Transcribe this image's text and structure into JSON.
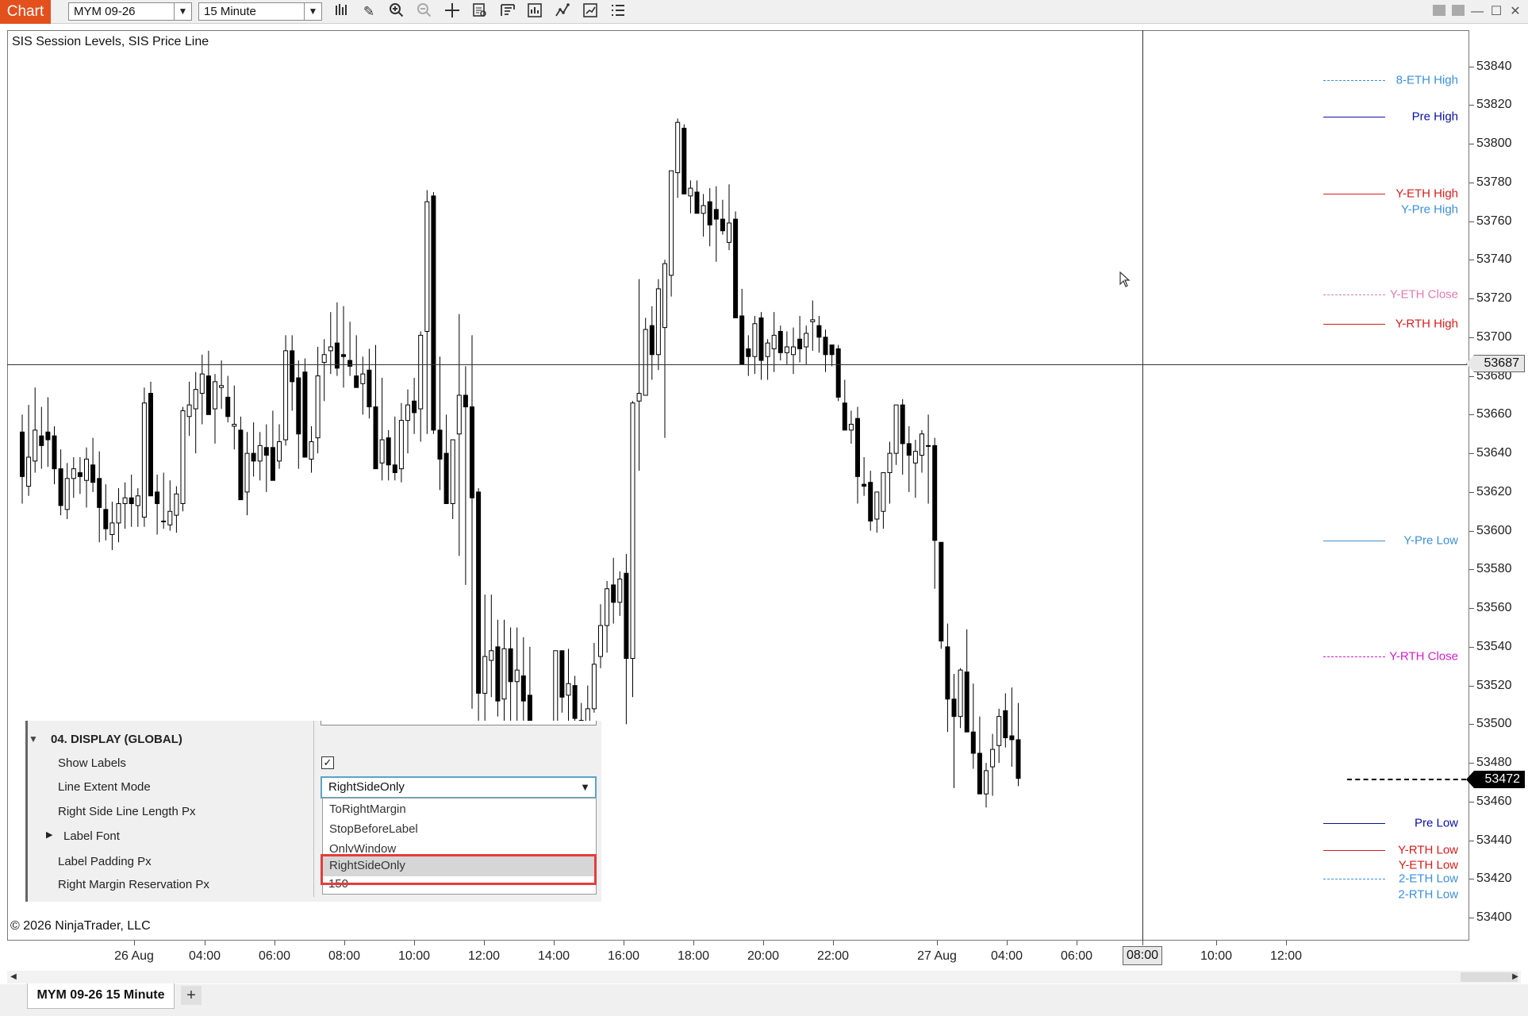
{
  "app": {
    "badge": "Chart"
  },
  "toolbar": {
    "instrument": "MYM 09-26",
    "interval": "15 Minute",
    "icons": [
      "bar-type-icon",
      "drawing-tool-icon",
      "zoom-in-icon",
      "zoom-out-icon",
      "crosshair-icon",
      "data-box-icon",
      "templates-icon",
      "properties-icon",
      "indicators-icon",
      "strategies-icon",
      "show-hide-icon"
    ]
  },
  "chart": {
    "indicator_label": "SIS Session Levels, SIS Price Line",
    "copyright": "© 2026 NinjaTrader, LLC",
    "crosshair_price": "53687",
    "crosshair_time": "08:00",
    "last_price": "53472",
    "price_ticks": [
      "53840",
      "53820",
      "53800",
      "53780",
      "53760",
      "53740",
      "53720",
      "53700",
      "53680",
      "53660",
      "53640",
      "53620",
      "53600",
      "53580",
      "53560",
      "53540",
      "53520",
      "53500",
      "53480",
      "53460",
      "53440",
      "53420",
      "53400"
    ],
    "time_ticks": [
      "26 Aug",
      "04:00",
      "06:00",
      "08:00",
      "10:00",
      "12:00",
      "14:00",
      "16:00",
      "18:00",
      "20:00",
      "22:00",
      "27 Aug",
      "04:00",
      "06:00",
      "08:00",
      "10:00",
      "12:00"
    ],
    "levels": [
      {
        "label": "8-ETH High",
        "price": 53833,
        "color": "#3d8fd8",
        "style": "dashed"
      },
      {
        "label": "Pre High",
        "price": 53814,
        "color": "#0a10a0",
        "style": "solid"
      },
      {
        "label": "Y-ETH High",
        "price": 53774,
        "color": "#d61c1c",
        "style": "solid"
      },
      {
        "label": "Y-Pre High",
        "price": 53766,
        "color": "#3d8fd8",
        "style": "none"
      },
      {
        "label": "Y-ETH Close",
        "price": 53722,
        "color": "#e07cb0",
        "style": "dashed"
      },
      {
        "label": "Y-RTH High",
        "price": 53707,
        "color": "#d61c1c",
        "style": "solid"
      },
      {
        "label": "Y-Pre Low",
        "price": 53595,
        "color": "#3d8fd8",
        "style": "solid"
      },
      {
        "label": "Y-RTH Close",
        "price": 53535,
        "color": "#d01ccc",
        "style": "dashed"
      },
      {
        "label": "Pre Low",
        "price": 53449,
        "color": "#0a10a0",
        "style": "solid"
      },
      {
        "label": "Y-RTH Low",
        "price": 53435,
        "color": "#d61c1c",
        "style": "solid"
      },
      {
        "label": "Y-ETH Low",
        "price": 53427,
        "color": "#d61c1c",
        "style": "none"
      },
      {
        "label": "2-ETH Low",
        "price": 53420,
        "color": "#3d8fd8",
        "style": "dashed"
      },
      {
        "label": "2-RTH Low",
        "price": 53412,
        "color": "#3d8fd8",
        "style": "none"
      }
    ]
  },
  "chart_data": {
    "type": "candlestick",
    "instrument": "MYM 09-26",
    "interval": "15 Minute",
    "ylim": [
      53390,
      53855
    ],
    "candles": [
      [
        53651,
        53660,
        53614,
        53628
      ],
      [
        53623,
        53665,
        53618,
        53638
      ],
      [
        53636,
        53674,
        53630,
        53652
      ],
      [
        53649,
        53664,
        53632,
        53644
      ],
      [
        53651,
        53669,
        53633,
        53647
      ],
      [
        53649,
        53654,
        53624,
        53632
      ],
      [
        53632,
        53642,
        53608,
        53613
      ],
      [
        53611,
        53635,
        53606,
        53627
      ],
      [
        53627,
        53638,
        53617,
        53632
      ],
      [
        53630,
        53638,
        53619,
        53628
      ],
      [
        53626,
        53643,
        53612,
        53637
      ],
      [
        53634,
        53648,
        53620,
        53625
      ],
      [
        53627,
        53641,
        53594,
        53612
      ],
      [
        53611,
        53624,
        53595,
        53601
      ],
      [
        53598,
        53615,
        53590,
        53604
      ],
      [
        53604,
        53622,
        53594,
        53614
      ],
      [
        53614,
        53625,
        53601,
        53617
      ],
      [
        53617,
        53629,
        53602,
        53614
      ],
      [
        53613,
        53622,
        53602,
        53618
      ],
      [
        53607,
        53674,
        53602,
        53666
      ],
      [
        53671,
        53677,
        53618,
        53618
      ],
      [
        53620,
        53629,
        53598,
        53614
      ],
      [
        53605,
        53630,
        53601,
        53605
      ],
      [
        53603,
        53626,
        53600,
        53610
      ],
      [
        53608,
        53623,
        53599,
        53619
      ],
      [
        53614,
        53664,
        53610,
        53662
      ],
      [
        53659,
        53677,
        53649,
        53665
      ],
      [
        53663,
        53682,
        53640,
        53673
      ],
      [
        53671,
        53691,
        53655,
        53681
      ],
      [
        53680,
        53693,
        53666,
        53660
      ],
      [
        53663,
        53681,
        53645,
        53677
      ],
      [
        53674,
        53688,
        53663,
        53675
      ],
      [
        53669,
        53680,
        53656,
        53659
      ],
      [
        53654,
        53675,
        53642,
        53655
      ],
      [
        53652,
        53659,
        53629,
        53616
      ],
      [
        53620,
        53651,
        53608,
        53640
      ],
      [
        53640,
        53656,
        53628,
        53636
      ],
      [
        53636,
        53651,
        53626,
        53644
      ],
      [
        53643,
        53655,
        53620,
        53639
      ],
      [
        53643,
        53662,
        53626,
        53626
      ],
      [
        53636,
        53655,
        53632,
        53646
      ],
      [
        53647,
        53701,
        53644,
        53693
      ],
      [
        53693,
        53701,
        53662,
        53677
      ],
      [
        53679,
        53688,
        53632,
        53650
      ],
      [
        53682,
        53689,
        53638,
        53638
      ],
      [
        53637,
        53654,
        53630,
        53646
      ],
      [
        53648,
        53695,
        53640,
        53680
      ],
      [
        53687,
        53699,
        53667,
        53691
      ],
      [
        53693,
        53713,
        53681,
        53695
      ],
      [
        53697,
        53718,
        53680,
        53684
      ],
      [
        53691,
        53716,
        53674,
        53690
      ],
      [
        53688,
        53708,
        53680,
        53685
      ],
      [
        53680,
        53701,
        53674,
        53674
      ],
      [
        53676,
        53690,
        53660,
        53681
      ],
      [
        53683,
        53694,
        53658,
        53664
      ],
      [
        53664,
        53696,
        53652,
        53632
      ],
      [
        53635,
        53679,
        53626,
        53647
      ],
      [
        53648,
        53652,
        53626,
        53634
      ],
      [
        53634,
        53659,
        53626,
        53630
      ],
      [
        53632,
        53666,
        53625,
        53657
      ],
      [
        53657,
        53673,
        53640,
        53665
      ],
      [
        53667,
        53679,
        53650,
        53661
      ],
      [
        53663,
        53703,
        53646,
        53701
      ],
      [
        53703,
        53776,
        53650,
        53770
      ],
      [
        53773,
        53775,
        53650,
        53652
      ],
      [
        53652,
        53690,
        53621,
        53637
      ],
      [
        53640,
        53660,
        53631,
        53614
      ],
      [
        53614,
        53633,
        53606,
        53647
      ],
      [
        53650,
        53712,
        53587,
        53670
      ],
      [
        53670,
        53685,
        53572,
        53664
      ],
      [
        53664,
        53701,
        53508,
        53617
      ],
      [
        53620,
        53622,
        53492,
        53516
      ],
      [
        53516,
        53567,
        53494,
        53535
      ],
      [
        53533,
        53567,
        53514,
        53538
      ],
      [
        53540,
        53554,
        53504,
        53512
      ],
      [
        53513,
        53554,
        53497,
        53539
      ],
      [
        53539,
        53550,
        53491,
        53522
      ],
      [
        53522,
        53550,
        53482,
        53528
      ],
      [
        53525,
        53545,
        53477,
        53512
      ],
      [
        53515,
        53540,
        53470,
        53450
      ],
      [
        53450,
        53490,
        53440,
        53475
      ],
      [
        53475,
        53498,
        53442,
        53451
      ],
      [
        53454,
        53490,
        53460,
        53500
      ],
      [
        53500,
        53537,
        53494,
        53538
      ],
      [
        53538,
        53538,
        53506,
        53514
      ],
      [
        53515,
        53539,
        53500,
        53521
      ],
      [
        53520,
        53525,
        53494,
        53503
      ],
      [
        53502,
        53511,
        53484,
        53492
      ],
      [
        53492,
        53520,
        53490,
        53508
      ],
      [
        53508,
        53542,
        53506,
        53531
      ],
      [
        53535,
        53562,
        53529,
        53551
      ],
      [
        53551,
        53574,
        53537,
        53570
      ],
      [
        53572,
        53586,
        53552,
        53563
      ],
      [
        53563,
        53579,
        53556,
        53575
      ],
      [
        53578,
        53588,
        53500,
        53534
      ],
      [
        53534,
        53667,
        53514,
        53666
      ],
      [
        53667,
        53730,
        53631,
        53671
      ],
      [
        53670,
        53710,
        53678,
        53704
      ],
      [
        53706,
        53716,
        53678,
        53691
      ],
      [
        53691,
        53730,
        53683,
        53725
      ],
      [
        53705,
        53740,
        53648,
        53738
      ],
      [
        53732,
        53786,
        53721,
        53786
      ],
      [
        53785,
        53813,
        53772,
        53811
      ],
      [
        53808,
        53810,
        53777,
        53774
      ],
      [
        53773,
        53781,
        53764,
        53777
      ],
      [
        53775,
        53781,
        53764,
        53764
      ],
      [
        53764,
        53774,
        53752,
        53768
      ],
      [
        53770,
        53777,
        53747,
        53758
      ],
      [
        53766,
        53778,
        53739,
        53761
      ],
      [
        53761,
        53771,
        53753,
        53755
      ],
      [
        53749,
        53779,
        53745,
        53759
      ],
      [
        53761,
        53765,
        53728,
        53710
      ],
      [
        53711,
        53725,
        53690,
        53686
      ],
      [
        53694,
        53701,
        53680,
        53690
      ],
      [
        53690,
        53711,
        53681,
        53707
      ],
      [
        53710,
        53713,
        53678,
        53688
      ],
      [
        53690,
        53699,
        53678,
        53697
      ],
      [
        53694,
        53713,
        53682,
        53701
      ],
      [
        53703,
        53706,
        53688,
        53692
      ],
      [
        53692,
        53703,
        53686,
        53695
      ],
      [
        53691,
        53705,
        53681,
        53695
      ],
      [
        53699,
        53711,
        53687,
        53694
      ],
      [
        53695,
        53706,
        53686,
        53702
      ],
      [
        53708,
        53719,
        53693,
        53709
      ],
      [
        53706,
        53711,
        53692,
        53700
      ],
      [
        53700,
        53704,
        53682,
        53691
      ],
      [
        53696,
        53696,
        53685,
        53691
      ],
      [
        53694,
        53696,
        53667,
        53669
      ],
      [
        53666,
        53678,
        53653,
        53652
      ],
      [
        53652,
        53662,
        53645,
        53655
      ],
      [
        53658,
        53664,
        53614,
        53628
      ],
      [
        53624,
        53638,
        53618,
        53623
      ],
      [
        53625,
        53631,
        53600,
        53605
      ],
      [
        53606,
        53612,
        53599,
        53620
      ],
      [
        53610,
        53628,
        53601,
        53630
      ],
      [
        53630,
        53646,
        53614,
        53640
      ],
      [
        53640,
        53662,
        53634,
        53665
      ],
      [
        53665,
        53668,
        53629,
        53645
      ],
      [
        53645,
        53654,
        53620,
        53639
      ],
      [
        53635,
        53647,
        53617,
        53641
      ],
      [
        53639,
        53652,
        53630,
        53650
      ],
      [
        53644,
        53660,
        53614,
        53644
      ],
      [
        53644,
        53648,
        53570,
        53595
      ],
      [
        53594,
        53589,
        53539,
        53543
      ],
      [
        53540,
        53552,
        53496,
        53513
      ],
      [
        53513,
        53526,
        53467,
        53504
      ],
      [
        53504,
        53529,
        53498,
        53528
      ],
      [
        53527,
        53549,
        53499,
        53496
      ],
      [
        53496,
        53521,
        53477,
        53485
      ],
      [
        53485,
        53504,
        53466,
        53464
      ],
      [
        53464,
        53480,
        53457,
        53476
      ],
      [
        53478,
        53495,
        53463,
        53487
      ],
      [
        53489,
        53508,
        53480,
        53504
      ],
      [
        53507,
        53516,
        53488,
        53493
      ],
      [
        53494,
        53519,
        53478,
        53492
      ],
      [
        53492,
        53511,
        53468,
        53472
      ]
    ]
  },
  "panel": {
    "section": "04. DISPLAY (GLOBAL)",
    "rows": [
      {
        "label": "Show Labels"
      },
      {
        "label": "Line Extent Mode"
      },
      {
        "label": "Right Side Line Length Px"
      },
      {
        "label": "Label Font"
      },
      {
        "label": "Label Padding Px"
      },
      {
        "label": "Right Margin Reservation Px"
      }
    ],
    "show_labels_checked": "✓",
    "extent_value": "RightSideOnly",
    "options": [
      "ToRightMargin",
      "StopBeforeLabel",
      "OnlyWindow",
      "RightSideOnly"
    ],
    "margin_value": "150"
  },
  "tabs": {
    "active": "MYM 09-26 15 Minute",
    "add": "+"
  }
}
